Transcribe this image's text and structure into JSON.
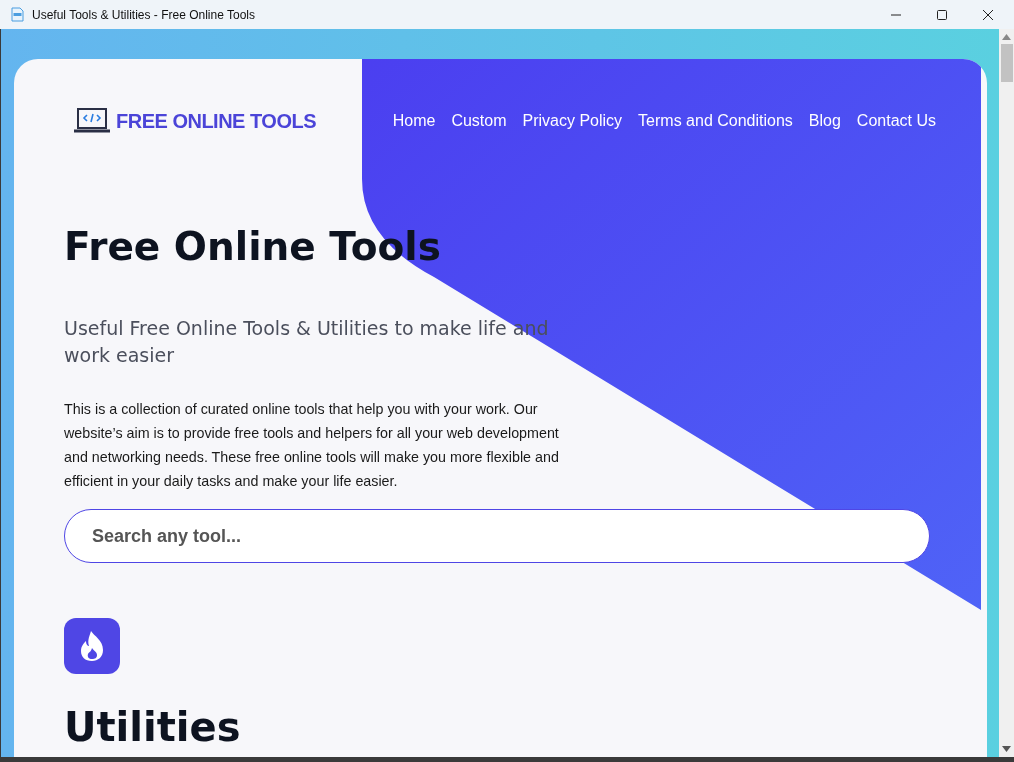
{
  "window": {
    "title": "Useful Tools & Utilities - Free Online Tools"
  },
  "logo": {
    "text": "FREE ONLINE TOOLS"
  },
  "nav": [
    {
      "label": "Home"
    },
    {
      "label": "Custom"
    },
    {
      "label": "Privacy Policy"
    },
    {
      "label": "Terms and Conditions"
    },
    {
      "label": "Blog"
    },
    {
      "label": "Contact Us"
    }
  ],
  "hero": {
    "title": "Free Online Tools",
    "subtitle": "Useful Free Online Tools & Utilities to make life and work easier",
    "description": "This is a collection of curated online tools that help you with your work. Our website’s aim is to provide free tools and helpers for all your web development and networking needs. These free online tools will make you more flexible and efficient in your daily tasks and make your life easier."
  },
  "search": {
    "placeholder": "Search any tool..."
  },
  "section": {
    "title": "Utilities"
  }
}
